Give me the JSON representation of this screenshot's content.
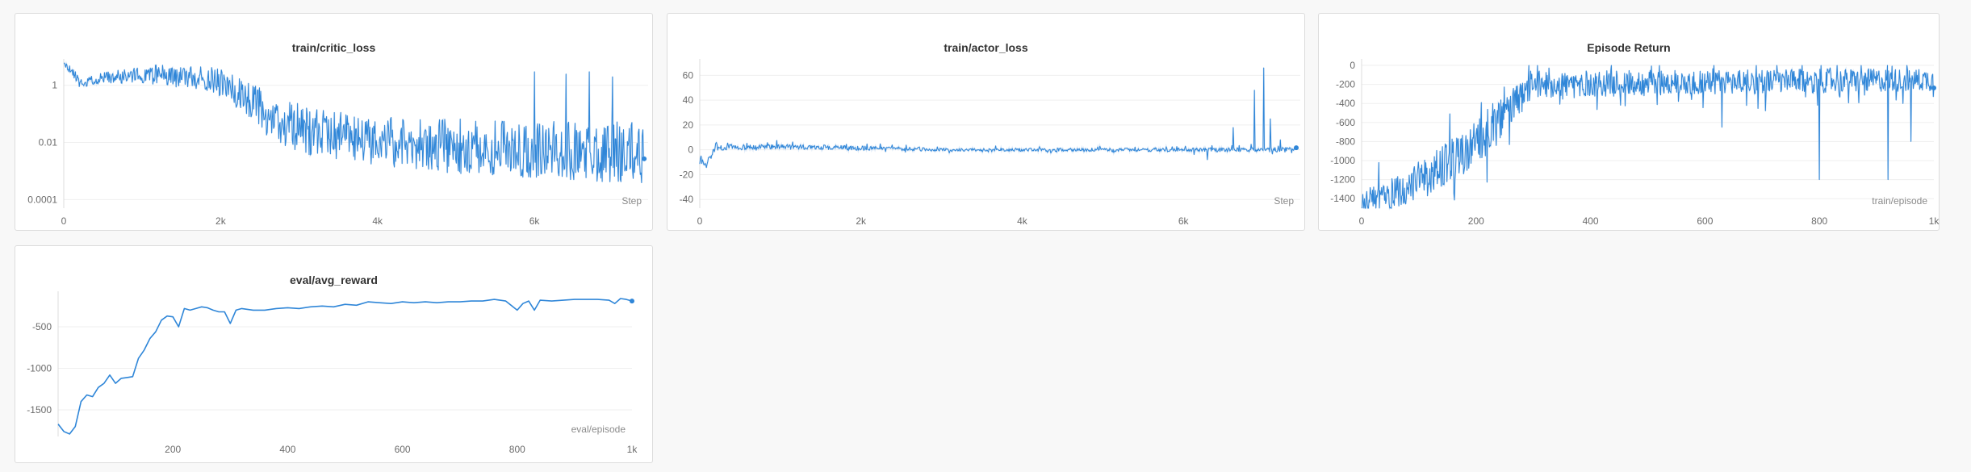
{
  "colors": {
    "series": "#2f86d8",
    "series_light": "#c9def4"
  },
  "chart_data": [
    {
      "id": "critic",
      "type": "line",
      "title": "train/critic_loss",
      "xlabel": "Step",
      "yscale": "log",
      "xlim": [
        0,
        7450
      ],
      "ylim": [
        5e-05,
        5
      ],
      "xticks": [
        0,
        2000,
        4000,
        6000
      ],
      "xtick_labels": [
        "0",
        "2k",
        "4k",
        "6k"
      ],
      "yticks": [
        1,
        0.01,
        0.0001
      ],
      "ytick_labels": [
        "1",
        "0.01",
        "0.0001"
      ],
      "series": [
        {
          "kind": "noisy",
          "points": 900,
          "x_end": 7400,
          "trend": [
            [
              0,
              6
            ],
            [
              100,
              3
            ],
            [
              200,
              1.2
            ],
            [
              1000,
              2.5
            ],
            [
              1800,
              1.8
            ],
            [
              2200,
              0.5
            ],
            [
              2600,
              0.06
            ],
            [
              3200,
              0.02
            ],
            [
              4500,
              0.008
            ],
            [
              6000,
              0.006
            ],
            [
              7400,
              0.004
            ]
          ],
          "noise_log10": [
            [
              0,
              0.12
            ],
            [
              2000,
              0.5
            ],
            [
              3000,
              0.85
            ],
            [
              6500,
              1.05
            ],
            [
              7400,
              1.1
            ]
          ],
          "ymax": 6,
          "ymin": 8e-05,
          "spikes": [
            [
              6000,
              3
            ],
            [
              6400,
              2.5
            ],
            [
              6700,
              3
            ],
            [
              7000,
              2
            ]
          ],
          "seed": 11
        }
      ]
    },
    {
      "id": "actor",
      "type": "line",
      "title": "train/actor_loss",
      "xlabel": "Step",
      "xlim": [
        0,
        7450
      ],
      "ylim": [
        -47,
        68
      ],
      "xticks": [
        0,
        2000,
        4000,
        6000
      ],
      "xtick_labels": [
        "0",
        "2k",
        "4k",
        "6k"
      ],
      "yticks": [
        60,
        40,
        20,
        0,
        -20,
        -40
      ],
      "ytick_labels": [
        "60",
        "40",
        "20",
        "0",
        "-20",
        "-40"
      ],
      "series": [
        {
          "kind": "noisy_linear",
          "points": 900,
          "x_end": 7400,
          "trend": [
            [
              0,
              -8
            ],
            [
              80,
              -12
            ],
            [
              200,
              2
            ],
            [
              1200,
              2.5
            ],
            [
              3000,
              0
            ],
            [
              7400,
              0
            ]
          ],
          "noise": [
            [
              0,
              2.5
            ],
            [
              1500,
              2
            ],
            [
              3000,
              1.2
            ],
            [
              6000,
              1.5
            ],
            [
              7400,
              2
            ]
          ],
          "spikes": [
            [
              6300,
              -8
            ],
            [
              6620,
              18
            ],
            [
              6880,
              48
            ],
            [
              7000,
              66
            ],
            [
              7080,
              25
            ],
            [
              7200,
              8
            ]
          ],
          "seed": 5
        }
      ]
    },
    {
      "id": "episode",
      "type": "line",
      "title": "Episode Return",
      "xlabel": "train/episode",
      "xlim": [
        0,
        1000
      ],
      "ylim": [
        -1500,
        0
      ],
      "xticks": [
        0,
        200,
        400,
        600,
        800,
        1000
      ],
      "xtick_labels": [
        "0",
        "200",
        "400",
        "600",
        "800",
        "1k"
      ],
      "yticks": [
        0,
        -200,
        -400,
        -600,
        -800,
        -1000,
        -1200,
        -1400
      ],
      "ytick_labels": [
        "0",
        "-200",
        "-400",
        "-600",
        "-800",
        "-1000",
        "-1200",
        "-1400"
      ],
      "series": [
        {
          "kind": "noisy_linear",
          "points": 1000,
          "x_end": 1000,
          "trend": [
            [
              0,
              -1450
            ],
            [
              60,
              -1350
            ],
            [
              120,
              -1150
            ],
            [
              200,
              -850
            ],
            [
              260,
              -450
            ],
            [
              300,
              -200
            ],
            [
              1000,
              -150
            ]
          ],
          "noise": [
            [
              0,
              150
            ],
            [
              200,
              260
            ],
            [
              300,
              140
            ],
            [
              1000,
              120
            ]
          ],
          "clip": [
            -1500,
            0
          ],
          "spikes": [
            [
              800,
              -1200
            ],
            [
              920,
              -1200
            ],
            [
              960,
              -800
            ],
            [
              630,
              -650
            ]
          ],
          "seed": 3
        }
      ]
    },
    {
      "id": "eval",
      "type": "line",
      "title": "eval/avg_reward",
      "xlabel": "eval/episode",
      "xlim": [
        0,
        1000
      ],
      "ylim": [
        -1820,
        -150
      ],
      "xticks": [
        200,
        400,
        600,
        800,
        1000
      ],
      "xtick_labels": [
        "200",
        "400",
        "600",
        "800",
        "1k"
      ],
      "yticks": [
        -500,
        -1000,
        -1500
      ],
      "ytick_labels": [
        "-500",
        "-1000",
        "-1500"
      ],
      "series": [
        {
          "kind": "points",
          "x": [
            0,
            10,
            20,
            30,
            40,
            50,
            60,
            70,
            80,
            90,
            100,
            110,
            120,
            130,
            140,
            150,
            160,
            170,
            180,
            190,
            200,
            210,
            220,
            230,
            240,
            250,
            260,
            270,
            280,
            290,
            300,
            310,
            320,
            340,
            360,
            380,
            400,
            420,
            440,
            460,
            480,
            500,
            520,
            540,
            560,
            580,
            600,
            620,
            640,
            660,
            680,
            700,
            720,
            740,
            760,
            780,
            800,
            810,
            820,
            830,
            840,
            860,
            880,
            900,
            920,
            940,
            960,
            970,
            980,
            990,
            1000
          ],
          "y": [
            -1670,
            -1760,
            -1790,
            -1700,
            -1400,
            -1320,
            -1340,
            -1230,
            -1180,
            -1080,
            -1180,
            -1120,
            -1110,
            -1100,
            -880,
            -780,
            -640,
            -560,
            -420,
            -370,
            -380,
            -500,
            -280,
            -300,
            -280,
            -260,
            -270,
            -300,
            -320,
            -320,
            -460,
            -300,
            -280,
            -300,
            -300,
            -280,
            -270,
            -280,
            -260,
            -250,
            -260,
            -230,
            -240,
            -200,
            -210,
            -220,
            -200,
            -210,
            -200,
            -210,
            -200,
            -200,
            -190,
            -190,
            -170,
            -190,
            -300,
            -220,
            -190,
            -300,
            -180,
            -190,
            -180,
            -170,
            -170,
            -170,
            -180,
            -220,
            -160,
            -170,
            -190
          ]
        }
      ]
    }
  ]
}
